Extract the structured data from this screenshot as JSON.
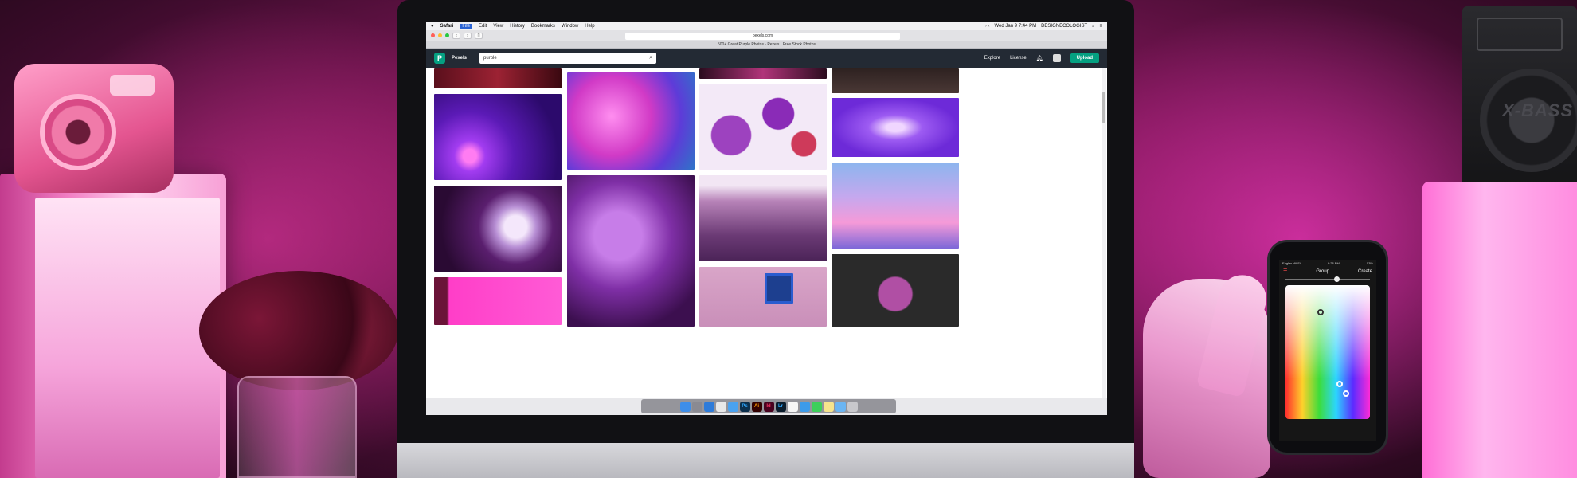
{
  "menubar": {
    "app": "Safari",
    "items": [
      "File",
      "Edit",
      "View",
      "History",
      "Bookmarks",
      "Window",
      "Help"
    ],
    "clock": "Wed Jan 9  7:44 PM",
    "user": "DESIGNECOLOGIST"
  },
  "browser": {
    "url": "pexels.com",
    "tab_title": "500+ Great Purple Photos · Pexels · Free Stock Photos"
  },
  "site": {
    "logo_letter": "P",
    "name": "Pexels",
    "search_value": "purple",
    "nav": [
      "Explore",
      "License"
    ],
    "upload_label": "Upload",
    "accent": "#05a081"
  },
  "phone": {
    "status_left": "Eagles Wi-Fi",
    "status_time": "8:28 PM",
    "status_right": "53%",
    "title": "Group",
    "action": "Create"
  },
  "speaker": {
    "brand": "X-BASS"
  },
  "dock_icons": [
    "finder-icon",
    "launchpad-icon",
    "safari-icon",
    "chrome-icon",
    "mail-icon",
    "photoshop-icon",
    "illustrator-icon",
    "indesign-icon",
    "lightroom-icon",
    "photos-icon",
    "finder2-icon",
    "messages-icon",
    "notes-icon",
    "folder-icon",
    "trash-icon"
  ],
  "dock_labels": [
    "Ps",
    "Ai",
    "Id",
    "Lr"
  ],
  "colors": {
    "ambient": "#b0207a",
    "site_header": "#232a34"
  }
}
